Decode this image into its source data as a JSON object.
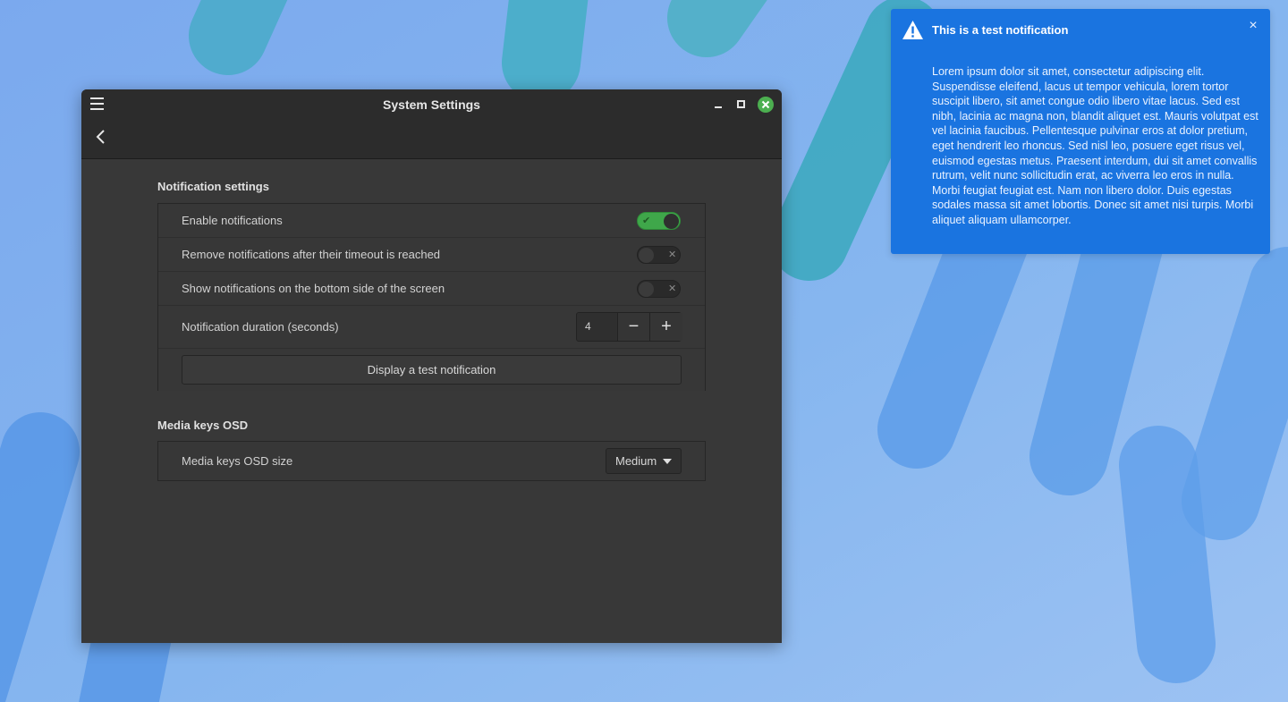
{
  "window": {
    "title": "System Settings"
  },
  "notification_settings": {
    "title": "Notification settings",
    "rows": [
      {
        "label": "Enable notifications",
        "enabled": true
      },
      {
        "label": "Remove notifications after their timeout is reached",
        "enabled": false
      },
      {
        "label": "Show notifications on the bottom side of the screen",
        "enabled": false
      }
    ],
    "duration": {
      "label": "Notification duration (seconds)",
      "value": "4",
      "decrement_symbol": "−",
      "increment_symbol": "+"
    },
    "test_button_label": "Display a test notification"
  },
  "media_keys": {
    "title": "Media keys OSD",
    "size_label": "Media keys OSD size",
    "size_value": "Medium"
  },
  "notification": {
    "icon": "warning-icon",
    "title": "This is a test notification",
    "close_symbol": "×",
    "body": "Lorem ipsum dolor sit amet, consectetur adipiscing elit. Suspendisse eleifend, lacus ut tempor vehicula, lorem tortor suscipit libero, sit amet congue odio libero vitae lacus. Sed est nibh, lacinia ac magna non, blandit aliquet est. Mauris volutpat est vel lacinia faucibus. Pellentesque pulvinar eros at dolor pretium, eget hendrerit leo rhoncus. Sed nisl leo, posuere eget risus vel, euismod egestas metus. Praesent interdum, dui sit amet convallis rutrum, velit nunc sollicitudin erat, ac viverra leo eros in nulla. Morbi feugiat feugiat est. Nam non libero dolor. Duis egestas sodales massa sit amet lobortis. Donec sit amet nisi turpis. Morbi aliquet aliquam ullamcorper."
  },
  "colors": {
    "accent_toggle_on": "#3fa74a",
    "notification_bg": "#1a74e0",
    "window_bg": "#383838",
    "titlebar_bg": "#2c2c2c"
  }
}
